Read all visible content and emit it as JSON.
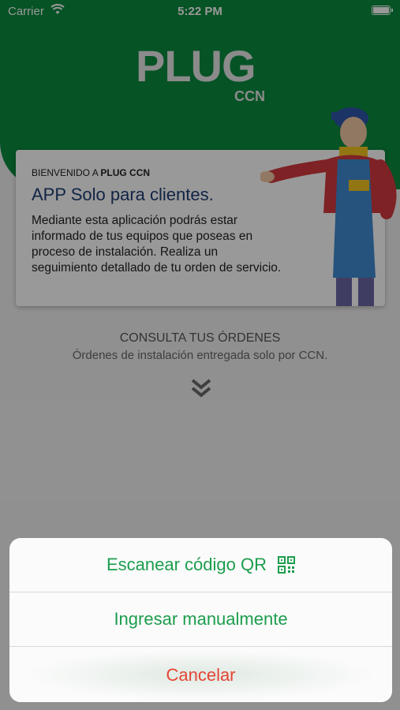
{
  "status_bar": {
    "carrier": "Carrier",
    "time": "5:22 PM"
  },
  "logo": {
    "main": "PLUG",
    "sub": "CCN"
  },
  "welcome_card": {
    "kicker_prefix": "BIENVENIDO A",
    "kicker_brand": "PLUG CCN",
    "title": "APP Solo para clientes.",
    "body": "Mediante esta aplicación podrás estar informado de tus equipos que poseas en proceso de instalación. Realiza un seguimiento detallado de tu orden de servicio."
  },
  "consult": {
    "title": "CONSULTA TUS ÓRDENES",
    "subtitle": "Órdenes de instalación entregada solo por CCN."
  },
  "action_sheet": {
    "scan_label": "Escanear código QR",
    "manual_label": "Ingresar manualmente",
    "cancel_label": "Cancelar"
  },
  "colors": {
    "brand_green": "#0a8a3e",
    "action_green": "#1c9d4d",
    "cancel_red": "#e54535",
    "title_blue": "#1f3c74"
  },
  "icons": {
    "wifi": "wifi-icon",
    "battery": "battery-icon",
    "chevrons": "double-chevron-down-icon",
    "qr": "qr-code-icon",
    "mascot": "technician-mascot"
  }
}
